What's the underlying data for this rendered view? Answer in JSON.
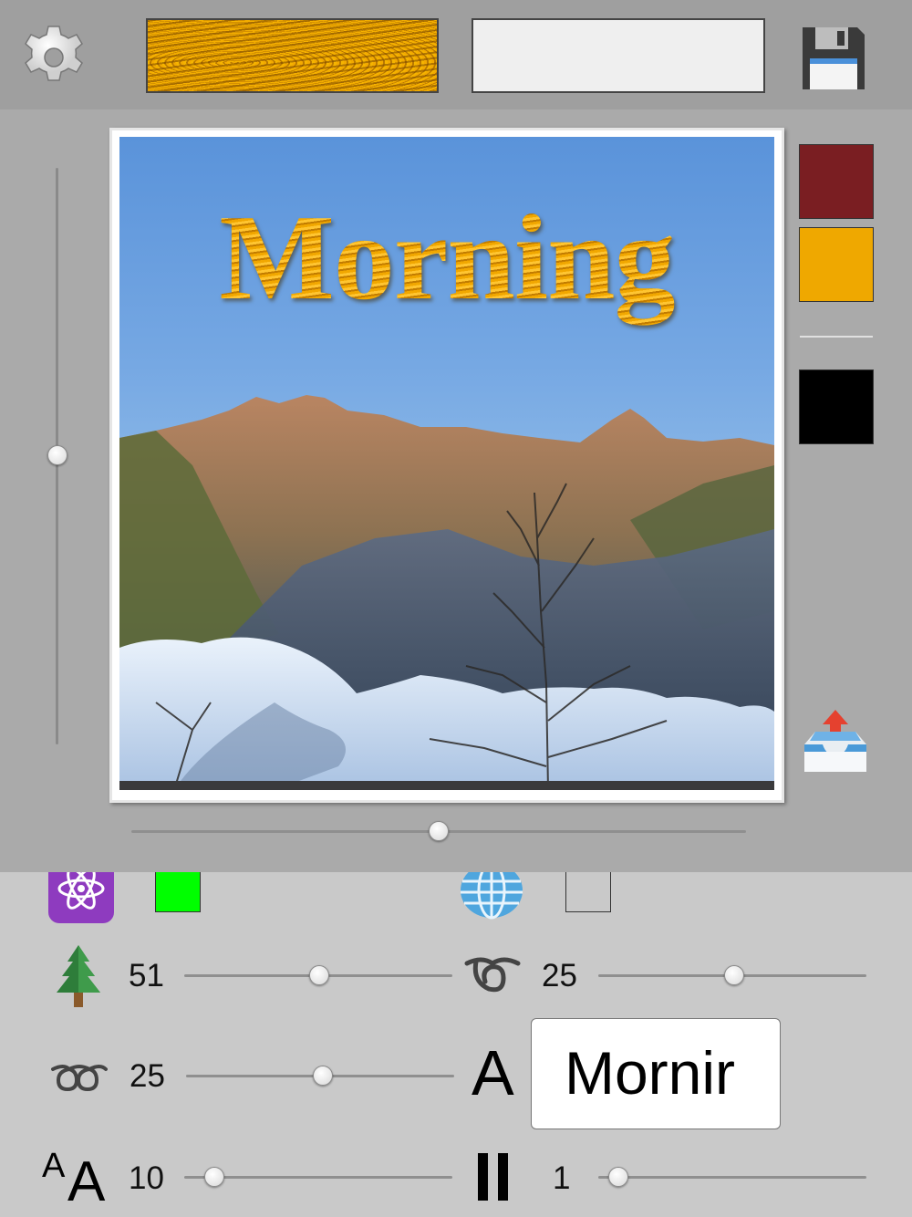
{
  "toolbar": {
    "settings_icon": "gear-icon",
    "texture_swatch": "wood-texture",
    "text_field_value": "",
    "save_icon": "floppy-disk-icon"
  },
  "canvas": {
    "headline": "Morning",
    "photo_subject": "mountain-landscape",
    "vertical_slider_value": 0.5,
    "horizontal_slider_value": 0.5
  },
  "palette": {
    "colors": [
      "#7a1e22",
      "#efa800",
      "#000000"
    ],
    "export_icon": "inbox-upload-icon"
  },
  "controls": {
    "row1": {
      "atom_icon": "atom-icon",
      "color_left": "#00ff00",
      "globe_icon": "globe-icon",
      "color_right": "#c9c9c9"
    },
    "tree": {
      "icon": "tree-icon",
      "value": "51",
      "fraction": 0.5
    },
    "loop": {
      "icon": "loop-icon",
      "value": "25",
      "fraction": 0.5
    },
    "double_loop": {
      "icon": "double-loop-icon",
      "value": "25",
      "fraction": 0.5
    },
    "font": {
      "label": "A",
      "value": "Mornir"
    },
    "text_size": {
      "icon": "text-size-icon",
      "value": "10",
      "fraction": 0.1
    },
    "pause": {
      "icon": "pause-icon",
      "value": "1",
      "fraction": 0.08
    }
  }
}
